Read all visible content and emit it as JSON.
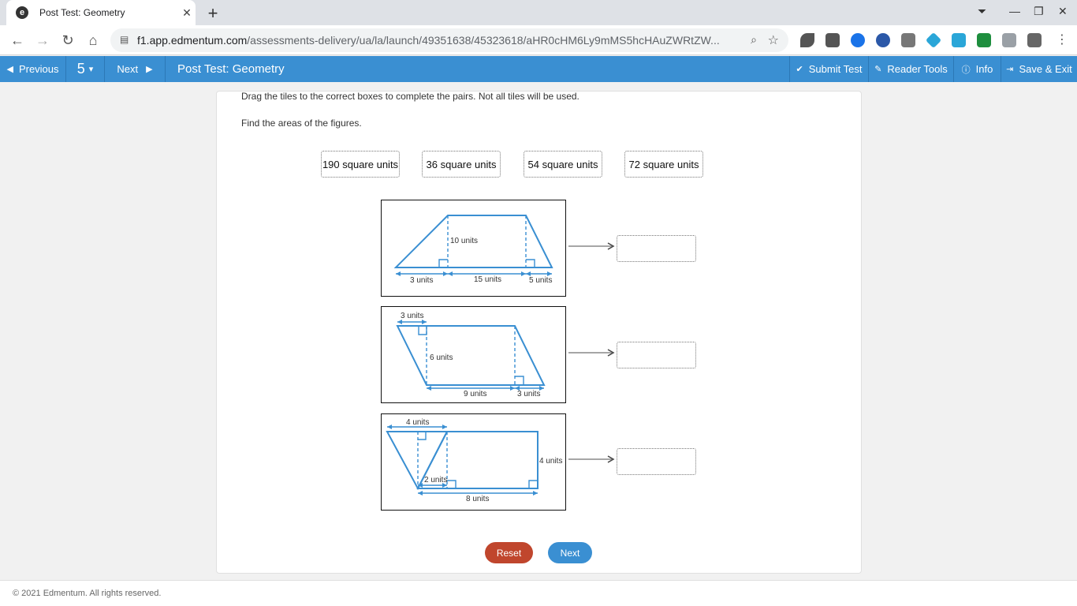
{
  "browser": {
    "tab_title": "Post Test: Geometry",
    "favicon_letter": "e",
    "url_host": "f1.app.edmentum.com",
    "url_path": "/assessments-delivery/ua/la/launch/49351638/45323618/aHR0cHM6Ly9mMS5hcHAuZWRtZW..."
  },
  "appbar": {
    "previous_label": "Previous",
    "question_number": "5",
    "next_label": "Next",
    "title": "Post Test: Geometry",
    "submit_label": "Submit Test",
    "reader_tools_label": "Reader Tools",
    "info_label": "Info",
    "save_exit_label": "Save & Exit"
  },
  "question": {
    "instructions": "Drag the tiles to the correct boxes to complete the pairs. Not all tiles will be used.",
    "prompt": "Find the areas of the figures.",
    "tiles": [
      "190 square units",
      "36 square units",
      "54 square units",
      "72 square units"
    ],
    "figures": [
      {
        "labels": {
          "height": "10 units",
          "left": "3 units",
          "mid": "15 units",
          "right": "5 units"
        }
      },
      {
        "labels": {
          "top": "3 units",
          "height": "6 units",
          "bottom": "9 units",
          "right": "3 units"
        }
      },
      {
        "labels": {
          "top": "4 units",
          "inner": "2 units",
          "height": "4 units",
          "bottom": "8 units"
        }
      }
    ]
  },
  "buttons": {
    "reset_label": "Reset",
    "next_label": "Next"
  },
  "footer": {
    "copyright": "© 2021 Edmentum. All rights reserved."
  },
  "colors": {
    "accent": "#3a8fd2",
    "reset": "#c0462d",
    "figure_stroke": "#3a8fd2"
  }
}
